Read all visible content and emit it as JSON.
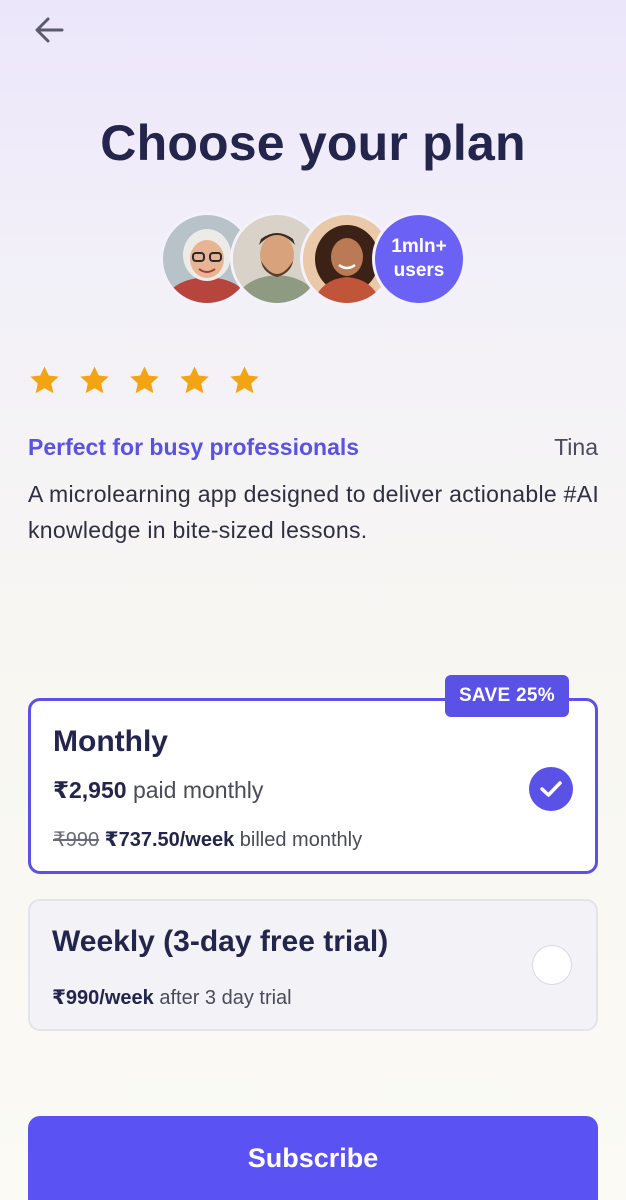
{
  "header": {
    "back_icon": "arrow-left-icon",
    "title": "Choose your plan"
  },
  "social_proof": {
    "badge_line1": "1mln+",
    "badge_line2": "users"
  },
  "review": {
    "rating": 5,
    "title": "Perfect for busy professionals",
    "author": "Tina",
    "text": "A microlearning app designed to deliver actionable #AI knowledge in bite-sized lessons."
  },
  "plans": [
    {
      "badge": "SAVE 25%",
      "name": "Monthly",
      "price": "₹2,950",
      "price_suffix": " paid monthly",
      "old_weekly": "₹990",
      "weekly": "₹737.50/week",
      "weekly_suffix": " billed monthly",
      "selected": true
    },
    {
      "name": "Weekly (3-day free trial)",
      "weekly": "₹990/week",
      "weekly_suffix": " after 3 day trial",
      "selected": false
    }
  ],
  "cta": {
    "label": "Subscribe"
  },
  "colors": {
    "accent": "#5a52e6",
    "star": "#f2a413",
    "title": "#24254d"
  }
}
